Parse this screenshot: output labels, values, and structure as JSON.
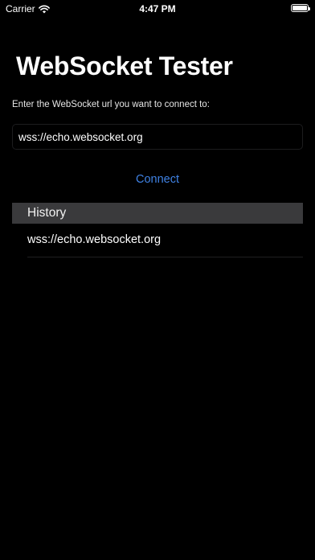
{
  "status_bar": {
    "carrier": "Carrier",
    "time": "4:47 PM",
    "wifi_icon": "wifi-icon",
    "battery_icon": "battery-icon",
    "battery_level": 1.0
  },
  "title": "WebSocket Tester",
  "prompt": "Enter the WebSocket url you want to connect to:",
  "url_input": {
    "value": "wss://echo.websocket.org"
  },
  "connect_label": "Connect",
  "history": {
    "header": "History",
    "items": [
      {
        "label": "wss://echo.websocket.org"
      }
    ]
  },
  "colors": {
    "background": "#000000",
    "accent": "#3f82e4",
    "section_header": "#3a3a3c"
  }
}
